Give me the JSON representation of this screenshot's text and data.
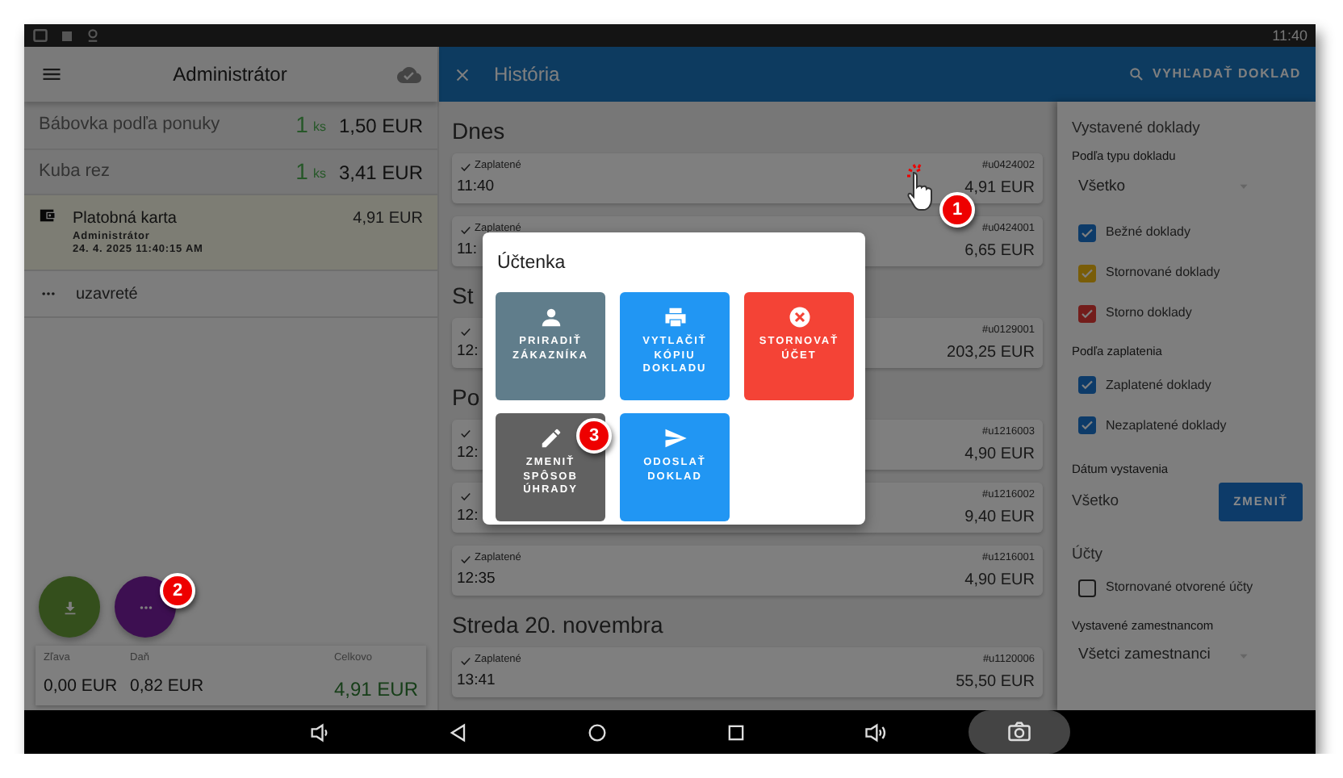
{
  "status_bar": {
    "time": "11:40"
  },
  "order_panel": {
    "title": "Administrátor",
    "items": [
      {
        "name": "Bábovka podľa ponuky",
        "qty": "1",
        "unit": "ks",
        "price": "1,50 EUR"
      },
      {
        "name": "Kuba rez",
        "qty": "1",
        "unit": "ks",
        "price": "3,41 EUR"
      }
    ],
    "payment": {
      "method": "Platobná karta",
      "user": "Administrátor",
      "datetime": "24. 4. 2025 11:40:15 AM",
      "amount": "4,91 EUR"
    },
    "state": "uzavreté",
    "summary": [
      {
        "label": "Zľava",
        "value": "0,00 EUR",
        "kind": "amount"
      },
      {
        "label": "Daň",
        "value": "0,82 EUR",
        "kind": "amount"
      },
      {
        "label": "Celkovo",
        "value": "4,91 EUR",
        "kind": "total"
      }
    ]
  },
  "history": {
    "title": "História",
    "search": "VYHĽADAŤ DOKLAD",
    "groups": [
      {
        "heading": "Dnes",
        "receipts": [
          {
            "paid": true,
            "status": "Zaplatené",
            "number": "#u0424002",
            "time": "11:40",
            "amount": "4,91 EUR"
          },
          {
            "paid": true,
            "status": "Zaplatené",
            "number": "#u0424001",
            "time": "11:",
            "amount": "6,65 EUR"
          }
        ]
      },
      {
        "heading": "St",
        "receipts": [
          {
            "paid": true,
            "number": "#u0129001",
            "time": "12:",
            "amount": "203,25 EUR"
          }
        ]
      },
      {
        "heading": "Po",
        "receipts": [
          {
            "paid": true,
            "number": "#u1216003",
            "time": "12:",
            "amount": "4,90 EUR"
          },
          {
            "paid": true,
            "number": "#u1216002",
            "time": "12:",
            "amount": "9,40 EUR"
          },
          {
            "paid": true,
            "status": "Zaplatené",
            "number": "#u1216001",
            "time": "12:35",
            "amount": "4,90 EUR"
          }
        ]
      },
      {
        "heading": "Streda 20. novembra",
        "receipts": [
          {
            "paid": true,
            "status": "Zaplatené",
            "number": "#u1120006",
            "time": "13:41",
            "amount": "55,50 EUR"
          }
        ]
      }
    ]
  },
  "filters": {
    "title": "Vystavené doklady",
    "type_label": "Podľa typu dokladu",
    "type_select": "Všetko",
    "type_checks": [
      {
        "label": "Bežné doklady",
        "checked": true,
        "color": "#0d3b69"
      },
      {
        "label": "Stornované doklady",
        "checked": true,
        "color": "#795d08"
      },
      {
        "label": "Storno doklady",
        "checked": true,
        "color": "#731d1b"
      }
    ],
    "payment_label": "Podľa zaplatenia",
    "payment_checks": [
      {
        "label": "Zaplatené doklady",
        "checked": true,
        "color": "#0d3b69"
      },
      {
        "label": "Nezaplatené doklady",
        "checked": true,
        "color": "#0d3b69"
      }
    ],
    "date_label": "Dátum vystavenia",
    "date_value": "Všetko",
    "date_button": "ZMENIŤ",
    "accounts_label": "Účty",
    "account_checks": [
      {
        "label": "Stornované otvorené účty",
        "checked": false
      }
    ],
    "employee_label": "Vystavené zamestnancom",
    "employee_select": "Všetci zamestnanci"
  },
  "dialog": {
    "title": "Účtenka",
    "actions": [
      {
        "kind": "person",
        "label": "PRIRADIŤ ZÁKAZNÍKA",
        "color": "#607d8b"
      },
      {
        "kind": "print",
        "label": "VYTLAČIŤ KÓPIU DOKLADU",
        "color": "#2196f3"
      },
      {
        "kind": "cancel",
        "label": "STORNOVAŤ ÚČET",
        "color": "#f44336"
      },
      {
        "kind": "edit",
        "label": "ZMENIŤ SPÔSOB ÚHRADY",
        "color": "#616161"
      },
      {
        "kind": "send",
        "label": "ODOSLAŤ DOKLAD",
        "color": "#2196f3"
      }
    ]
  },
  "callouts": [
    {
      "label": "1"
    },
    {
      "label": "2"
    },
    {
      "label": "3"
    }
  ]
}
